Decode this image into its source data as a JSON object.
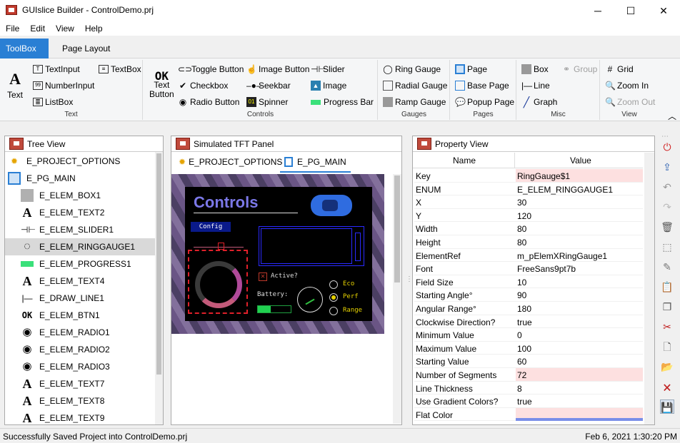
{
  "window": {
    "title": "GUIslice Builder - ControlDemo.prj",
    "minimize": "─",
    "maximize": "☐",
    "close": "✕"
  },
  "menu": [
    "File",
    "Edit",
    "View",
    "Help"
  ],
  "tabs": [
    "ToolBox",
    "Page Layout"
  ],
  "ribbon": {
    "text_group": {
      "label": "Text",
      "big_label": "Text",
      "items": [
        "TextInput",
        "TextBox",
        "NumberInput",
        "ListBox"
      ]
    },
    "controls_group": {
      "label": "Controls",
      "text_button": [
        "Text",
        "Button"
      ],
      "items": [
        "Toggle Button",
        "Image Button",
        "Slider",
        "Checkbox",
        "Seekbar",
        "Image",
        "Radio Button",
        "Spinner",
        "Progress Bar"
      ]
    },
    "gauges_group": {
      "label": "Gauges",
      "items": [
        "Ring Gauge",
        "Radial Gauge",
        "Ramp Gauge"
      ]
    },
    "pages_group": {
      "label": "Pages",
      "items": [
        "Page",
        "Base Page",
        "Popup Page"
      ]
    },
    "misc_group": {
      "label": "Misc",
      "items": [
        "Box",
        "Group",
        "Line",
        "Graph"
      ]
    },
    "view_group": {
      "label": "View",
      "items": [
        "Grid",
        "Zoom In",
        "Zoom Out"
      ]
    }
  },
  "tree_view": {
    "title": "Tree View",
    "items": [
      "E_PROJECT_OPTIONS",
      "E_PG_MAIN",
      "E_ELEM_BOX1",
      "E_ELEM_TEXT2",
      "E_ELEM_SLIDER1",
      "E_ELEM_RINGGAUGE1",
      "E_ELEM_PROGRESS1",
      "E_ELEM_TEXT4",
      "E_DRAW_LINE1",
      "E_ELEM_BTN1",
      "E_ELEM_RADIO1",
      "E_ELEM_RADIO2",
      "E_ELEM_RADIO3",
      "E_ELEM_TEXT7",
      "E_ELEM_TEXT8",
      "E_ELEM_TEXT9"
    ],
    "selected": "E_ELEM_RINGGAUGE1"
  },
  "tft_panel": {
    "title": "Simulated TFT Panel",
    "tabs": [
      "E_PROJECT_OPTIONS",
      "E_PG_MAIN"
    ],
    "screen": {
      "heading": "Controls",
      "config": "Config",
      "active": "Active?",
      "battery": "Battery:",
      "radios": [
        "Eco",
        "Perf",
        "Range"
      ]
    }
  },
  "property_view": {
    "title": "Property View",
    "col_name": "Name",
    "col_value": "Value",
    "rows": [
      {
        "k": "Key",
        "v": "RingGauge$1"
      },
      {
        "k": "ENUM",
        "v": "E_ELEM_RINGGAUGE1"
      },
      {
        "k": "X",
        "v": "30"
      },
      {
        "k": "Y",
        "v": "120"
      },
      {
        "k": "Width",
        "v": "80"
      },
      {
        "k": "Height",
        "v": "80"
      },
      {
        "k": "ElementRef",
        "v": "m_pElemXRingGauge1"
      },
      {
        "k": "Font",
        "v": "FreeSans9pt7b"
      },
      {
        "k": "Field Size",
        "v": "10"
      },
      {
        "k": "Starting Angle°",
        "v": "90"
      },
      {
        "k": "Angular Range°",
        "v": "180"
      },
      {
        "k": "Clockwise Direction?",
        "v": "true"
      },
      {
        "k": "Minimum Value",
        "v": "0"
      },
      {
        "k": "Maximum Value",
        "v": "100"
      },
      {
        "k": "Starting Value",
        "v": "60"
      },
      {
        "k": "Number of Segments",
        "v": "72"
      },
      {
        "k": "Line Thickness",
        "v": "8"
      },
      {
        "k": "Use Gradient Colors?",
        "v": "true"
      },
      {
        "k": "Flat Color",
        "v": ""
      }
    ]
  },
  "status": {
    "message": "Successfully Saved Project into ControlDemo.prj",
    "datetime": "Feb 6, 2021 1:30:20 PM"
  }
}
